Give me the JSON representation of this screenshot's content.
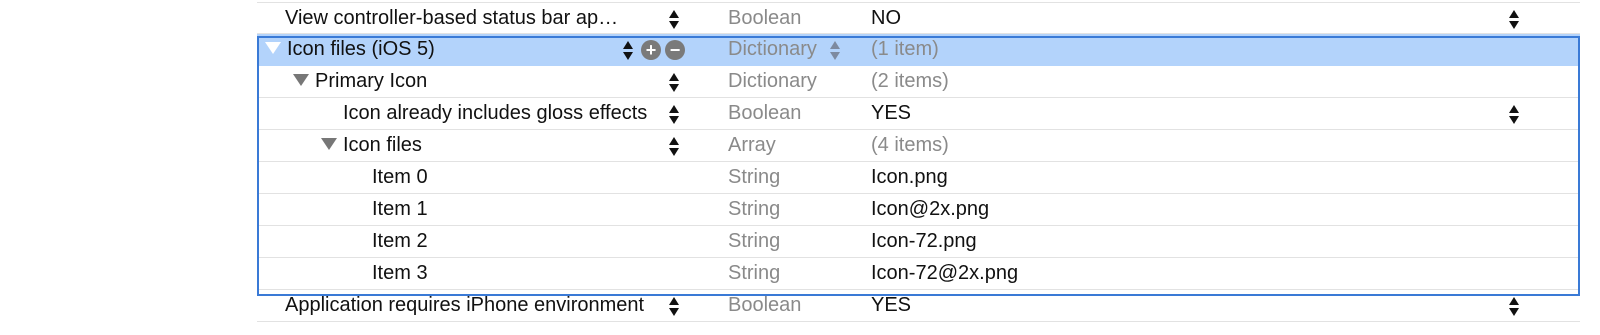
{
  "rows": [
    {
      "key": "View controller-based status bar ap…",
      "type": "Boolean",
      "value": "NO"
    },
    {
      "key": "Icon files (iOS 5)",
      "type": "Dictionary",
      "value": "(1 item)"
    },
    {
      "key": "Primary Icon",
      "type": "Dictionary",
      "value": "(2 items)"
    },
    {
      "key": "Icon already includes gloss effects",
      "type": "Boolean",
      "value": "YES"
    },
    {
      "key": "Icon files",
      "type": "Array",
      "value": "(4 items)"
    },
    {
      "key": "Item 0",
      "type": "String",
      "value": "Icon.png"
    },
    {
      "key": "Item 1",
      "type": "String",
      "value": "Icon@2x.png"
    },
    {
      "key": "Item 2",
      "type": "String",
      "value": "Icon-72.png"
    },
    {
      "key": "Item 3",
      "type": "String",
      "value": "Icon-72@2x.png"
    },
    {
      "key": "Application requires iPhone environment",
      "type": "Boolean",
      "value": "YES"
    }
  ],
  "selected_row": "Icon files (iOS 5)",
  "icons": {
    "add": "plus-circle-icon",
    "remove": "minus-circle-icon",
    "disclosure": "disclosure-triangle-icon",
    "stepper": "up-down-stepper-icon"
  },
  "colors": {
    "selection": "#b3d3fb",
    "group_border": "#3a7ad6",
    "muted_text": "#8a8a8a"
  }
}
